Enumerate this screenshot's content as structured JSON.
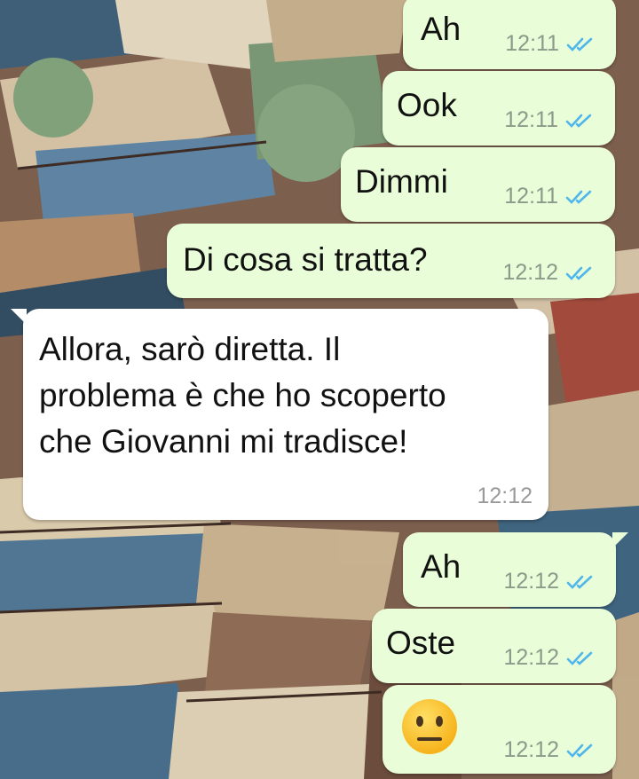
{
  "colors": {
    "outgoing_bubble": "#e9fdd8",
    "incoming_bubble": "#ffffff",
    "read_ticks": "#4fb6ec",
    "timestamp_out": "#8c9a89",
    "timestamp_in": "#9a9a9a"
  },
  "messages": [
    {
      "direction": "outgoing",
      "text": "Ah",
      "time": "12:11",
      "status": "read"
    },
    {
      "direction": "outgoing",
      "text": "Ook",
      "time": "12:11",
      "status": "read"
    },
    {
      "direction": "outgoing",
      "text": "Dimmi",
      "time": "12:11",
      "status": "read"
    },
    {
      "direction": "outgoing",
      "text": "Di cosa si tratta?",
      "time": "12:12",
      "status": "read"
    },
    {
      "direction": "incoming",
      "lines": [
        "Allora, sarò diretta. Il",
        "problema è che ho scoperto",
        "che Giovanni mi tradisce!"
      ],
      "time": "12:12"
    },
    {
      "direction": "outgoing",
      "text": "Ah",
      "time": "12:12",
      "status": "read"
    },
    {
      "direction": "outgoing",
      "text": "Oste",
      "time": "12:12",
      "status": "read"
    },
    {
      "direction": "outgoing",
      "emoji": "neutral-face",
      "time": "12:12",
      "status": "read"
    }
  ]
}
